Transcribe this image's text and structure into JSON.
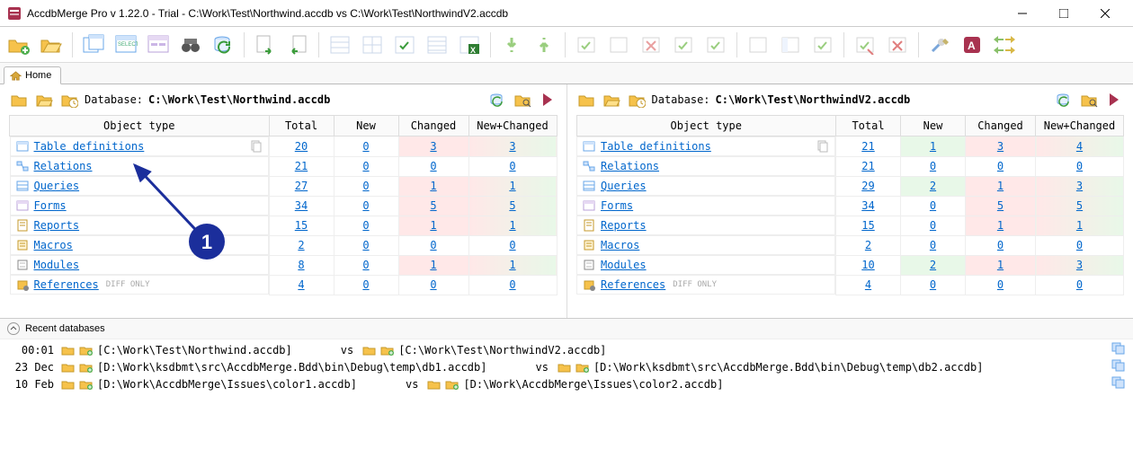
{
  "window": {
    "title": "AccdbMerge Pro v 1.22.0 - Trial - C:\\Work\\Test\\Northwind.accdb vs C:\\Work\\Test\\NorthwindV2.accdb"
  },
  "tabs": {
    "home": "Home"
  },
  "cols": {
    "obj": "Object type",
    "total": "Total",
    "new": "New",
    "changed": "Changed",
    "newchg": "New+Changed"
  },
  "left": {
    "dbLabel": "Database:",
    "path": "C:\\Work\\Test\\Northwind.accdb",
    "rows": [
      {
        "name": "Table definitions",
        "total": "20",
        "new": "0",
        "chg": "3",
        "nc": "3",
        "chgCls": "chg-red"
      },
      {
        "name": "Relations",
        "total": "21",
        "new": "0",
        "chg": "0",
        "nc": "0"
      },
      {
        "name": "Queries",
        "total": "27",
        "new": "0",
        "chg": "1",
        "nc": "1",
        "chgCls": "chg-red"
      },
      {
        "name": "Forms",
        "total": "34",
        "new": "0",
        "chg": "5",
        "nc": "5",
        "chgCls": "chg-red"
      },
      {
        "name": "Reports",
        "total": "15",
        "new": "0",
        "chg": "1",
        "nc": "1",
        "chgCls": "chg-red"
      },
      {
        "name": "Macros",
        "total": "2",
        "new": "0",
        "chg": "0",
        "nc": "0"
      },
      {
        "name": "Modules",
        "total": "8",
        "new": "0",
        "chg": "1",
        "nc": "1",
        "chgCls": "chg-red"
      },
      {
        "name": "References",
        "diff": "DIFF ONLY",
        "total": "4",
        "new": "0",
        "chg": "0",
        "nc": "0"
      }
    ]
  },
  "right": {
    "dbLabel": "Database:",
    "path": "C:\\Work\\Test\\NorthwindV2.accdb",
    "rows": [
      {
        "name": "Table definitions",
        "total": "21",
        "new": "1",
        "chg": "3",
        "nc": "4",
        "newCls": "new-grn",
        "chgCls": "chg-red"
      },
      {
        "name": "Relations",
        "total": "21",
        "new": "0",
        "chg": "0",
        "nc": "0"
      },
      {
        "name": "Queries",
        "total": "29",
        "new": "2",
        "chg": "1",
        "nc": "3",
        "newCls": "new-grn",
        "chgCls": "chg-red"
      },
      {
        "name": "Forms",
        "total": "34",
        "new": "0",
        "chg": "5",
        "nc": "5",
        "chgCls": "chg-red"
      },
      {
        "name": "Reports",
        "total": "15",
        "new": "0",
        "chg": "1",
        "nc": "1",
        "chgCls": "chg-red"
      },
      {
        "name": "Macros",
        "total": "2",
        "new": "0",
        "chg": "0",
        "nc": "0"
      },
      {
        "name": "Modules",
        "total": "10",
        "new": "2",
        "chg": "1",
        "nc": "3",
        "newCls": "new-grn",
        "chgCls": "chg-red"
      },
      {
        "name": "References",
        "diff": "DIFF ONLY",
        "total": "4",
        "new": "0",
        "chg": "0",
        "nc": "0"
      }
    ]
  },
  "callout": "1",
  "recent": {
    "label": "Recent databases",
    "vs": "vs",
    "items": [
      {
        "time": "00:01",
        "l": "[C:\\Work\\Test\\Northwind.accdb]",
        "r": "[C:\\Work\\Test\\NorthwindV2.accdb]"
      },
      {
        "time": "23 Dec",
        "l": "[D:\\Work\\ksdbmt\\src\\AccdbMerge.Bdd\\bin\\Debug\\temp\\db1.accdb]",
        "r": "[D:\\Work\\ksdbmt\\src\\AccdbMerge.Bdd\\bin\\Debug\\temp\\db2.accdb]"
      },
      {
        "time": "10 Feb",
        "l": "[D:\\Work\\AccdbMerge\\Issues\\color1.accdb]",
        "r": "[D:\\Work\\AccdbMerge\\Issues\\color2.accdb]"
      }
    ]
  }
}
